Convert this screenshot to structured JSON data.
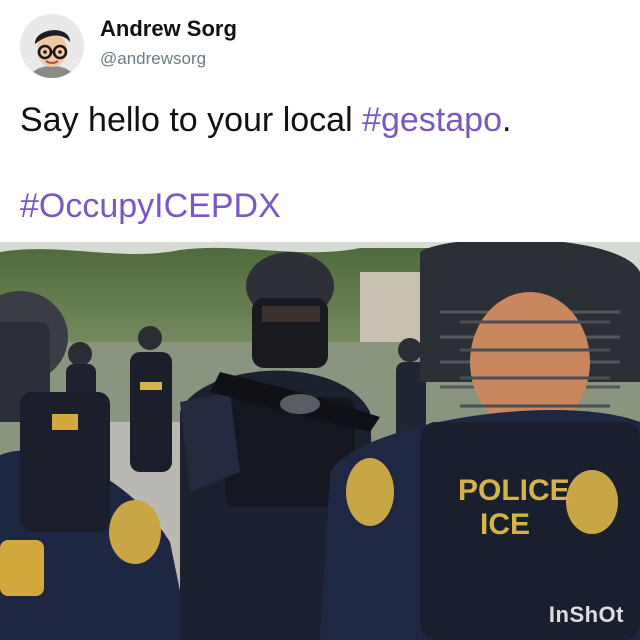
{
  "tweet": {
    "author_name": "Andrew Sorg",
    "author_handle": "@andrewsorg",
    "text_plain": "Say hello to your local ",
    "text_hashtag": "#gestapo",
    "text_end": ".",
    "hashtag_2": "#OccupyICEPDX"
  },
  "video": {
    "vest_text_line1": "POLICE",
    "vest_text_line2": "ICE",
    "watermark": "InShOt"
  },
  "colors": {
    "hashtag": "#7b57c2",
    "handle": "#6e7a84",
    "text": "#111111"
  }
}
